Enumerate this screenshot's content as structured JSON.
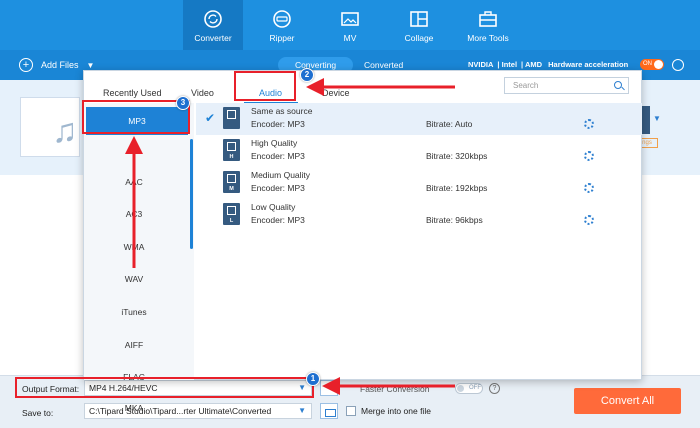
{
  "nav": {
    "items": [
      {
        "label": "Converter",
        "icon": "converter-icon"
      },
      {
        "label": "Ripper",
        "icon": "ripper-icon"
      },
      {
        "label": "MV",
        "icon": "mv-icon"
      },
      {
        "label": "Collage",
        "icon": "collage-icon"
      },
      {
        "label": "More Tools",
        "icon": "toolbox-icon"
      }
    ]
  },
  "subbar": {
    "add_files": "Add Files",
    "tabs": [
      "Converting",
      "Converted"
    ],
    "hw": {
      "nvidia": "NVIDIA",
      "intel": "Intel",
      "amd": "AMD",
      "label": "Hardware acceleration"
    },
    "hw_toggle": "ON"
  },
  "background": {
    "tag": "ngs"
  },
  "popup": {
    "tabs": {
      "recent": "Recently Used",
      "video": "Video",
      "audio": "Audio",
      "device": "Device"
    },
    "search_placeholder": "Search",
    "formats": [
      "MP3",
      "AAC",
      "AC3",
      "WMA",
      "WAV",
      "iTunes",
      "AIFF",
      "FLAC",
      "MKA"
    ],
    "presets": [
      {
        "name": "Same as source",
        "encoder": "Encoder: MP3",
        "bitrate": "Bitrate: Auto",
        "badge": ""
      },
      {
        "name": "High Quality",
        "encoder": "Encoder: MP3",
        "bitrate": "Bitrate: 320kbps",
        "badge": "H"
      },
      {
        "name": "Medium Quality",
        "encoder": "Encoder: MP3",
        "bitrate": "Bitrate: 192kbps",
        "badge": "M"
      },
      {
        "name": "Low Quality",
        "encoder": "Encoder: MP3",
        "bitrate": "Bitrate: 96kbps",
        "badge": "L"
      }
    ]
  },
  "footer": {
    "output_format_label": "Output Format:",
    "output_format_value": "MP4 H.264/HEVC",
    "save_to_label": "Save to:",
    "save_to_value": "C:\\Tipard Studio\\Tipard...rter Ultimate\\Converted",
    "faster_conversion": "Faster Conversion",
    "toggle_off": "OFF",
    "help": "?",
    "merge_label": "Merge into one file",
    "convert_all": "Convert All"
  },
  "annotations": {
    "badges": [
      "1",
      "2",
      "3"
    ]
  },
  "colors": {
    "accent": "#1e82d6",
    "topbar": "#1e90e0",
    "annotation": "#e8202a",
    "convert": "#ff6a3a"
  }
}
